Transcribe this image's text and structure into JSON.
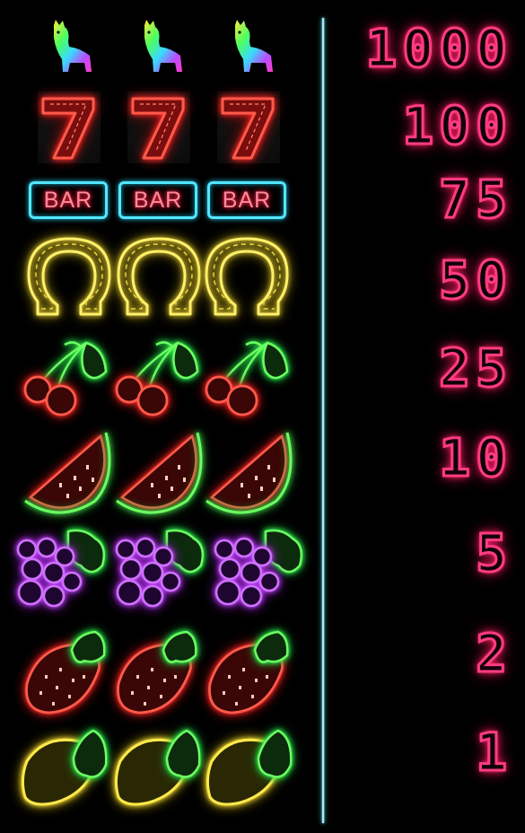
{
  "paytable": {
    "rows": [
      {
        "symbol": "llama-icon",
        "payout": "1000"
      },
      {
        "symbol": "seven-icon",
        "payout": "100"
      },
      {
        "symbol": "bar-icon",
        "payout": "75",
        "bar_text": "BAR"
      },
      {
        "symbol": "horseshoe-icon",
        "payout": "50"
      },
      {
        "symbol": "cherry-icon",
        "payout": "25"
      },
      {
        "symbol": "watermelon-icon",
        "payout": "10"
      },
      {
        "symbol": "grapes-icon",
        "payout": "5"
      },
      {
        "symbol": "strawberry-icon",
        "payout": "2"
      },
      {
        "symbol": "lemon-icon",
        "payout": "1"
      }
    ]
  },
  "colors": {
    "payout_neon": "#ff3c82",
    "divider": "#9feefa",
    "background": "#000000"
  }
}
